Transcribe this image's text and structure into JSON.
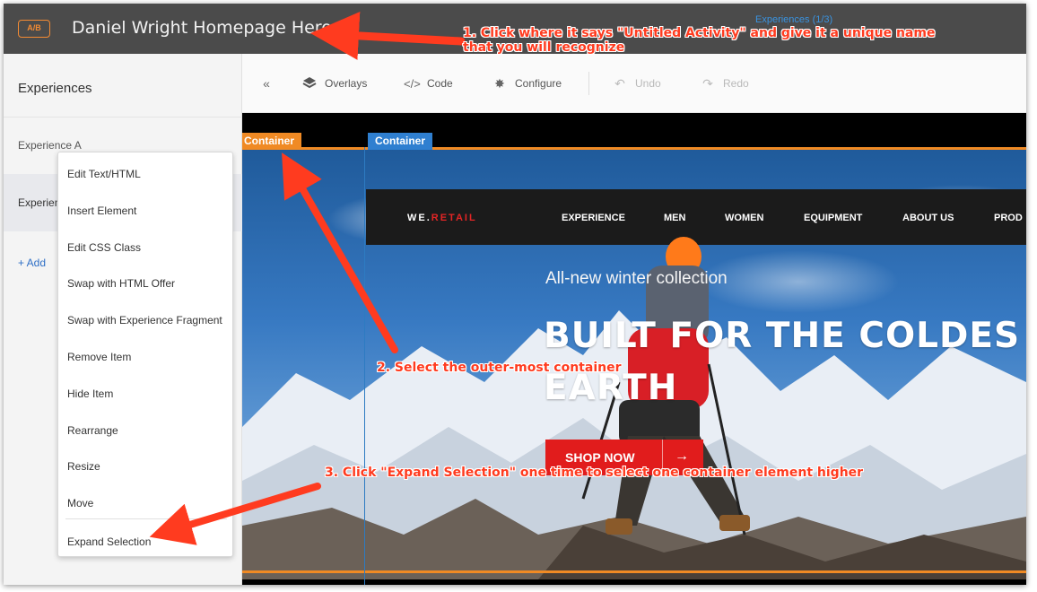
{
  "header": {
    "badge": "A/B",
    "activity_title": "Daniel Wright Homepage Hero",
    "experience_counter": "Experiences (1/3)"
  },
  "sidebar": {
    "title": "Experiences",
    "items": [
      {
        "label": "Experience A"
      },
      {
        "label": "Experience B"
      }
    ],
    "add_label": "+ Add"
  },
  "toolbar": {
    "collapse_icon": "double-chevron-left",
    "items": [
      {
        "label": "Overlays",
        "icon": "layers-icon"
      },
      {
        "label": "Code",
        "icon": "code-icon"
      },
      {
        "label": "Configure",
        "icon": "gear-icon"
      },
      {
        "label": "Undo",
        "icon": "undo-icon",
        "disabled": true
      },
      {
        "label": "Redo",
        "icon": "redo-icon",
        "disabled": true
      }
    ]
  },
  "canvas": {
    "container_tags": [
      "Container",
      "Container"
    ],
    "site": {
      "brand_prefix": "WE.",
      "brand_accent": "RETAIL",
      "nav": [
        "EXPERIENCE",
        "MEN",
        "WOMEN",
        "EQUIPMENT",
        "ABOUT US",
        "PROD"
      ]
    },
    "hero": {
      "subtitle": "All-new winter collection",
      "title_line1": "BUILT FOR THE COLDES",
      "title_line2": "EARTH",
      "cta": "SHOP NOW",
      "cta_arrow": "→"
    }
  },
  "context_menu": {
    "items": [
      "Edit Text/HTML",
      "Insert Element",
      "Edit CSS Class",
      "Swap with HTML Offer",
      "Swap with Experience Fragment",
      "Remove Item",
      "Hide Item",
      "Rearrange",
      "Resize",
      "Move",
      "Expand Selection"
    ]
  },
  "annotations": {
    "step1_line1": "1. Click where it says \"Untitled Activity\" and give it a unique name",
    "step1_line2": "that you will recognize",
    "step2": "2. Select the outer-most container",
    "step3": "3. Click \"Expand Selection\" one time to select one container element higher"
  },
  "colors": {
    "topbar": "#4b4b4b",
    "accent_orange": "#f08a24",
    "accent_blue": "#2f7fd0",
    "cta_red": "#e11c1c",
    "annotation_red": "#ff3b1f"
  }
}
